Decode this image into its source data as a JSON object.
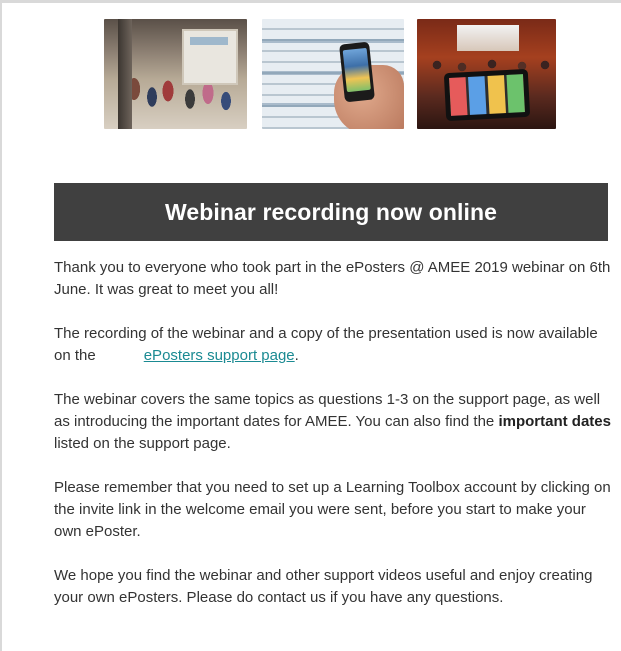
{
  "images": [
    {
      "alt": "poster-hall-crowd"
    },
    {
      "alt": "phone-in-hand-posters"
    },
    {
      "alt": "auditorium-tablet"
    }
  ],
  "banner": {
    "title": "Webinar recording now online"
  },
  "paragraphs": {
    "p1": "Thank you to everyone who took part in the ePosters @ AMEE 2019 webinar on 6th June. It was great to meet you all!",
    "p2_before": "The recording of the webinar and a copy of the presentation used is now available on the",
    "p2_link": "ePosters support page",
    "p2_after": ".",
    "p3_before": "The webinar covers the same topics as questions 1-3 on the support page, as well as introducing the important dates for AMEE. You can also find the",
    "p3_bold": "important dates",
    "p3_after": "listed on the support page.",
    "p4": "Please remember that you need to set up a Learning Toolbox account by clicking on the invite link in the welcome email you were sent, before you start to make your own ePoster.",
    "p5": "We hope you find the webinar and other support videos useful and enjoy creating your own ePosters. Please do contact us if you have any questions."
  },
  "colors": {
    "banner_bg": "#404040",
    "link": "#1a8a92",
    "text": "#333333"
  }
}
